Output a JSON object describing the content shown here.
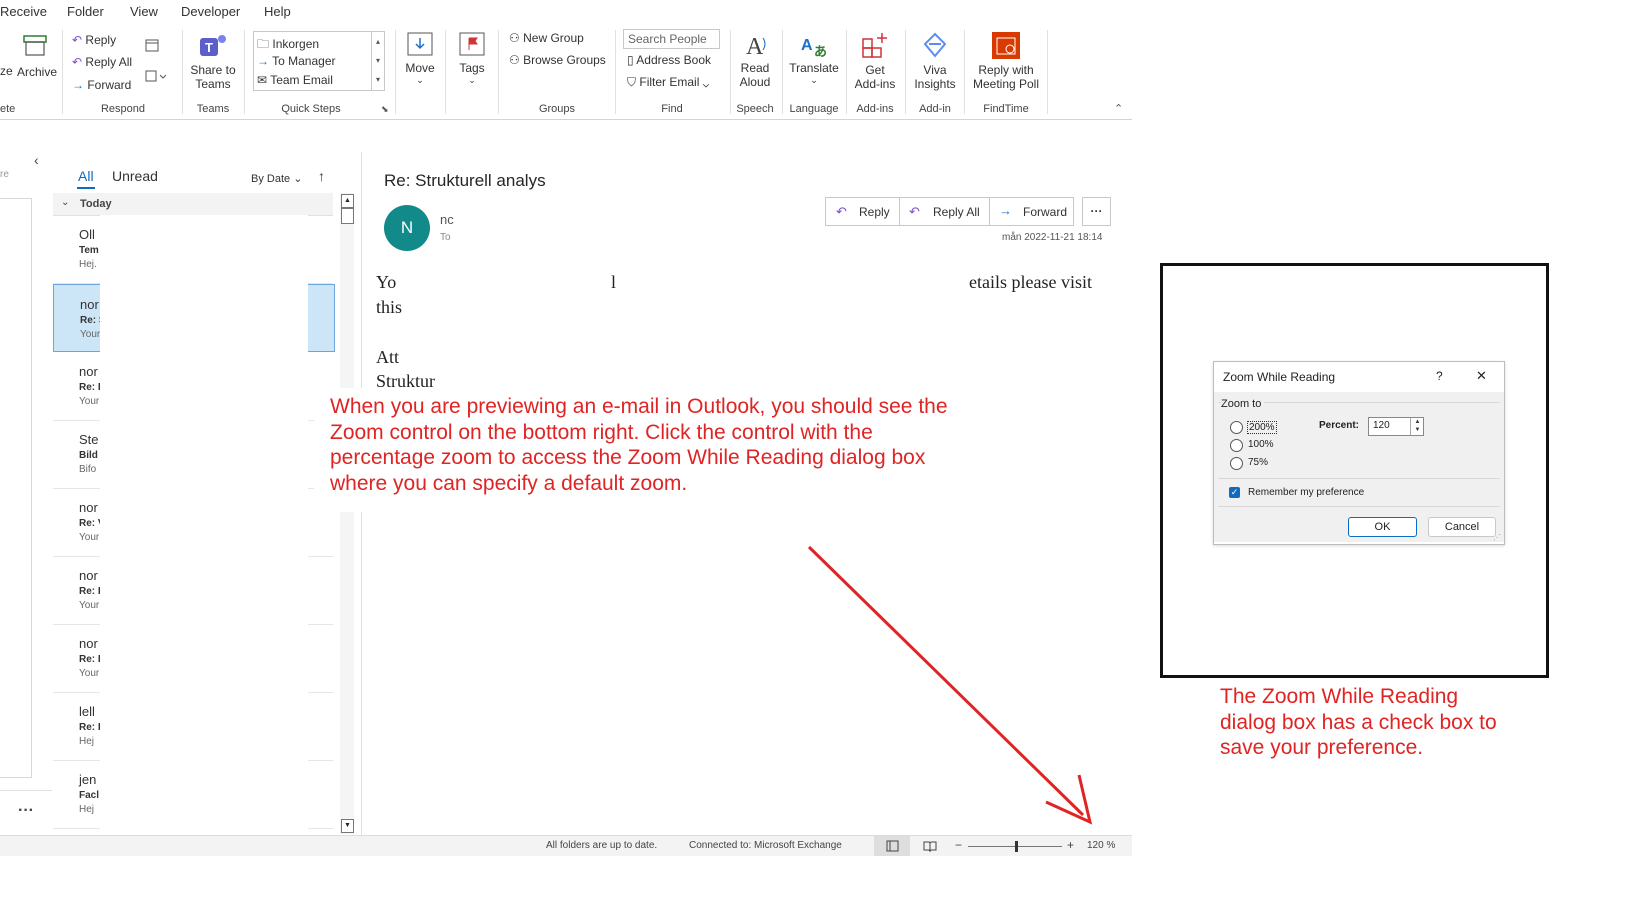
{
  "menu": [
    "Receive",
    "Folder",
    "View",
    "Developer",
    "Help"
  ],
  "ribbon": {
    "delete_group_label": "ete",
    "archive_label": "Archive",
    "respond": {
      "reply": "Reply",
      "reply_all": "Reply All",
      "forward": "Forward",
      "label": "Respond"
    },
    "teams": {
      "share_line1": "Share to",
      "share_line2": "Teams",
      "label": "Teams"
    },
    "quick_steps": {
      "items": [
        "Inkorgen",
        "To Manager",
        "Team Email"
      ],
      "label": "Quick Steps"
    },
    "move": {
      "label": "Move"
    },
    "tags": {
      "label": "Tags"
    },
    "groups": {
      "new_group": "New Group",
      "browse_groups": "Browse Groups",
      "label": "Groups"
    },
    "find": {
      "search_placeholder": "Search People",
      "address_book": "Address Book",
      "filter_email": "Filter Email",
      "label": "Find"
    },
    "speech": {
      "line1": "Read",
      "line2": "Aloud",
      "label": "Speech"
    },
    "language": {
      "line1": "Translate",
      "label": "Language"
    },
    "addins": {
      "line1": "Get",
      "line2": "Add-ins",
      "label": "Add-ins"
    },
    "viva": {
      "line1": "Viva",
      "line2": "Insights",
      "label": "Add-in"
    },
    "findtime": {
      "line1": "Reply with",
      "line2": "Meeting Poll",
      "label": "FindTime"
    }
  },
  "folder_pane": {
    "partial_text": "re",
    "collapse": "‹"
  },
  "message_list": {
    "tab_all": "All",
    "tab_unread": "Unread",
    "sort": "By Date",
    "group_header": "Today",
    "items": [
      {
        "name": "Oll",
        "subject": "Tem",
        "preview": "Hej."
      },
      {
        "name": "nor",
        "subject": "Re: S",
        "preview": "Your"
      },
      {
        "name": "nor",
        "subject": "Re: I",
        "preview": "Your"
      },
      {
        "name": "Ste",
        "subject": "Bild",
        "preview": "Bifo"
      },
      {
        "name": "nor",
        "subject": "Re: V",
        "preview": "Your"
      },
      {
        "name": "nor",
        "subject": "Re: I",
        "preview": "Your"
      },
      {
        "name": "nor",
        "subject": "Re: I",
        "preview": "Your"
      },
      {
        "name": "lell",
        "subject": "Re: I",
        "preview": "Hej"
      },
      {
        "name": "jen",
        "subject": "Facl",
        "preview": "Hej"
      }
    ]
  },
  "reading": {
    "subject": "Re: Strukturell analys",
    "avatar_initial": "N",
    "sender": "nc",
    "to": "To",
    "reply": "Reply",
    "reply_all": "Reply All",
    "forward": "Forward",
    "more": "···",
    "date": "mån 2022-11-21 18:14",
    "body_line1_a": "Yo",
    "body_line1_b": "l",
    "body_line1_c": "etails please visit",
    "body_line2": "this",
    "body_line3": "Att",
    "body_line4": "Struktur"
  },
  "status": {
    "left": "All folders are up to date.",
    "connection": "Connected to: Microsoft Exchange",
    "zoom": "120 %"
  },
  "dialog": {
    "title": "Zoom While Reading",
    "help": "?",
    "close": "✕",
    "group_label": "Zoom to",
    "options": [
      "200%",
      "100%",
      "75%"
    ],
    "percent_label": "Percent:",
    "percent_value": "120",
    "remember": "Remember my preference",
    "ok": "OK",
    "cancel": "Cancel"
  },
  "annotations": {
    "main": [
      "When you are previewing an e-mail in Outlook, you should see the",
      "Zoom control on the bottom right. Click the control with the",
      "percentage zoom to access the Zoom While Reading dialog box",
      "where you can specify a default zoom."
    ],
    "side": [
      "The Zoom While Reading",
      "dialog box has a check box to",
      "save your preference."
    ]
  },
  "colors": {
    "annotation": "#e02424",
    "accent": "#0f6cbd",
    "avatar": "#138a8a",
    "selection": "#cde6f7"
  }
}
